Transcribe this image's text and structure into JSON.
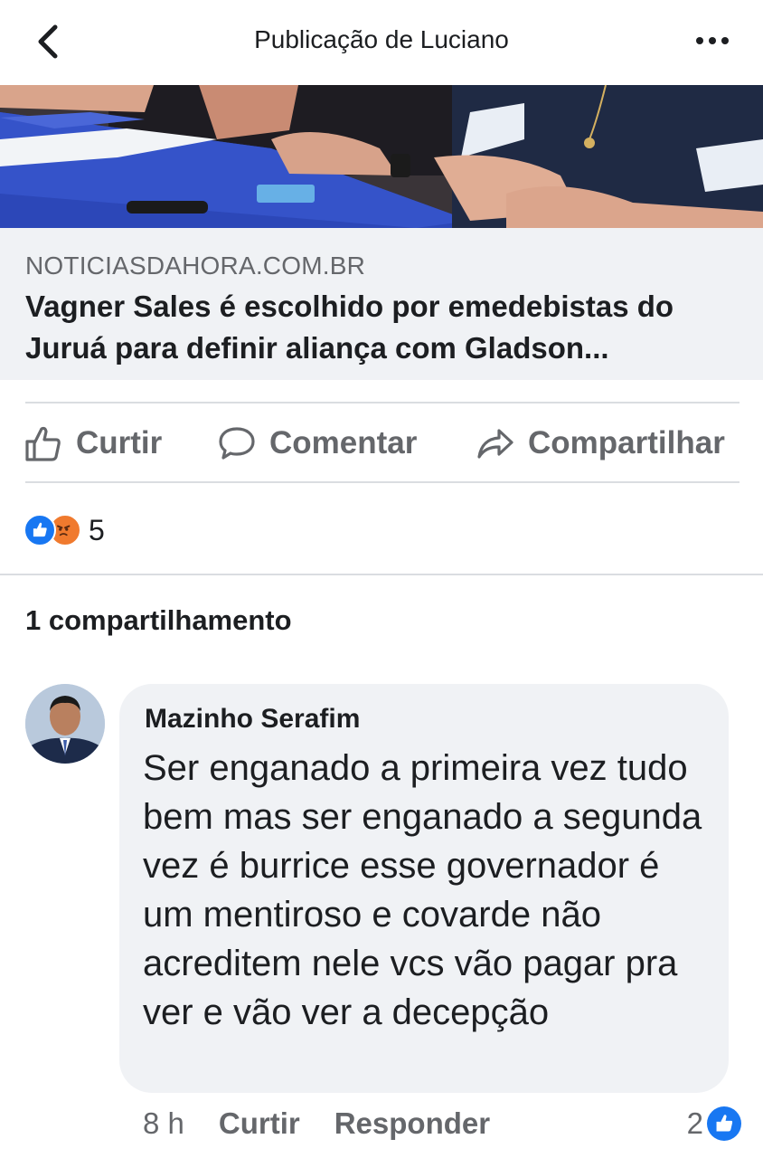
{
  "header": {
    "title": "Publicação de Luciano"
  },
  "link_preview": {
    "domain": "NOTICIASDAHORA.COM.BR",
    "headline": "Vagner Sales é escolhido por emedebistas do Juruá para definir aliança com Gladson..."
  },
  "actions": {
    "like": "Curtir",
    "comment": "Comentar",
    "share": "Compartilhar"
  },
  "reactions": {
    "count": "5"
  },
  "shares": {
    "label": "1 compartilhamento"
  },
  "comment": {
    "author": "Mazinho Serafim",
    "text": "Ser enganado a primeira vez tudo bem mas ser enganado a segunda vez é burrice esse governador é um mentiroso e covarde não acreditem nele vcs vão pagar pra ver e vão ver a decepção",
    "time": "8 h",
    "like_action": "Curtir",
    "reply_action": "Responder",
    "like_count": "2"
  },
  "colors": {
    "brand_blue": "#1877f2",
    "angry_orange": "#f07a2e",
    "muted_text": "#65676b",
    "bubble_bg": "#f0f2f5"
  }
}
